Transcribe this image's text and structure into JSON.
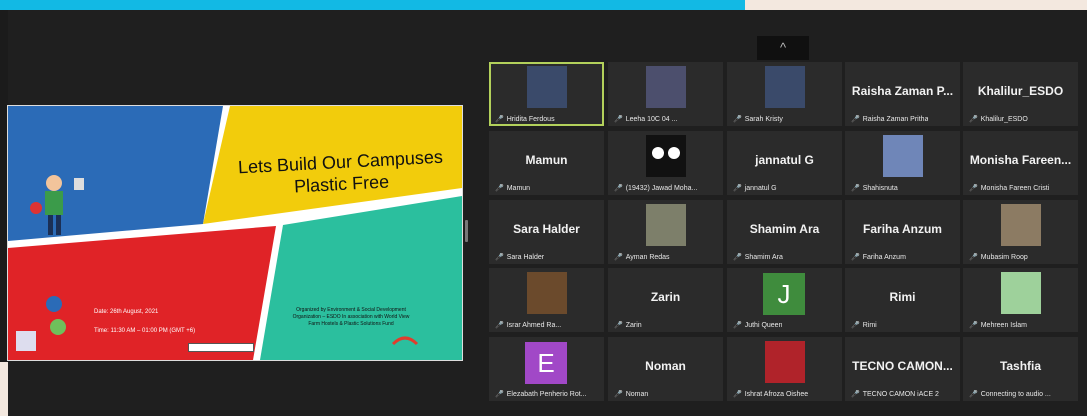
{
  "colors": {
    "topbar": "#12b9e4",
    "topbar_right": "#f3e8df",
    "active_border": "#b3d15b",
    "muted_mic": "#e34a3b",
    "letter_j": "#3f8c3d",
    "letter_e": "#a148c7"
  },
  "slide": {
    "title": "Lets Build Our Campuses Plastic Free",
    "date": "Date: 26th August, 2021",
    "time": "Time: 11:30 AM – 01:00 PM (GMT +6)",
    "org": "Organized by Environment & Social Development Organization – ESDO In association with World View Farm Hostels & Plastic Solutions Fund"
  },
  "gallery": {
    "collapse_icon": "^",
    "participants": [
      {
        "label": "Hridita Ferdous",
        "big": "",
        "icon": "person-photo-icon",
        "active": true
      },
      {
        "label": "Leeha 10C 04 ...",
        "big": "",
        "icon": "city-lights-photo-icon",
        "active": false
      },
      {
        "label": "Sarah Kristy",
        "big": "",
        "icon": "person-photo-icon",
        "active": false
      },
      {
        "label": "Raisha Zaman Pritha",
        "big": "Raisha Zaman P...",
        "icon": "",
        "active": false
      },
      {
        "label": "Khalilur_ESDO",
        "big": "Khalilur_ESDO",
        "icon": "",
        "active": false
      },
      {
        "label": "Mamun",
        "big": "Mamun",
        "icon": "",
        "active": false
      },
      {
        "label": "(19432) Jawad Moha...",
        "big": "",
        "icon": "cartoon-face-icon",
        "active": false
      },
      {
        "label": "jannatul G",
        "big": "jannatul G",
        "icon": "",
        "active": false
      },
      {
        "label": "Shahisnuta",
        "big": "",
        "icon": "moon-photo-icon",
        "active": false
      },
      {
        "label": "Monisha Fareen Cristi",
        "big": "Monisha Fareen...",
        "icon": "",
        "active": false
      },
      {
        "label": "Sara Halder",
        "big": "Sara Halder",
        "icon": "",
        "active": false
      },
      {
        "label": "Ayman Redas",
        "big": "",
        "icon": "scenery-photo-icon",
        "active": false
      },
      {
        "label": "Shamim Ara",
        "big": "Shamim Ara",
        "icon": "",
        "active": false
      },
      {
        "label": "Fariha Anzum",
        "big": "Fariha Anzum",
        "icon": "",
        "active": false
      },
      {
        "label": "Mubasim Roop",
        "big": "",
        "icon": "horses-photo-icon",
        "active": false
      },
      {
        "label": "Israr Ahmed Ra...",
        "big": "",
        "icon": "anime-photo-icon",
        "active": false
      },
      {
        "label": "Zarin",
        "big": "Zarin",
        "icon": "",
        "active": false
      },
      {
        "label": "Juthi Queen",
        "big": "",
        "icon": "letter-avatar-icon",
        "letter": "J",
        "active": false
      },
      {
        "label": "Rimi",
        "big": "Rimi",
        "icon": "",
        "active": false
      },
      {
        "label": "Mehreen Islam",
        "big": "",
        "icon": "cartoon-crewmate-icon",
        "active": false
      },
      {
        "label": "Elezabath Penherio Rot...",
        "big": "",
        "icon": "letter-avatar-icon",
        "letter": "E",
        "active": false
      },
      {
        "label": "Noman",
        "big": "Noman",
        "icon": "",
        "active": false
      },
      {
        "label": "Ishrat Afroza Oishee",
        "big": "",
        "icon": "red-photo-icon",
        "active": false
      },
      {
        "label": "TECNO CAMON iACE 2",
        "big": "TECNO CAMON...",
        "icon": "",
        "active": false
      },
      {
        "label": "Connecting to audio ...",
        "big": "Tashfia",
        "icon": "",
        "active": false
      }
    ]
  }
}
